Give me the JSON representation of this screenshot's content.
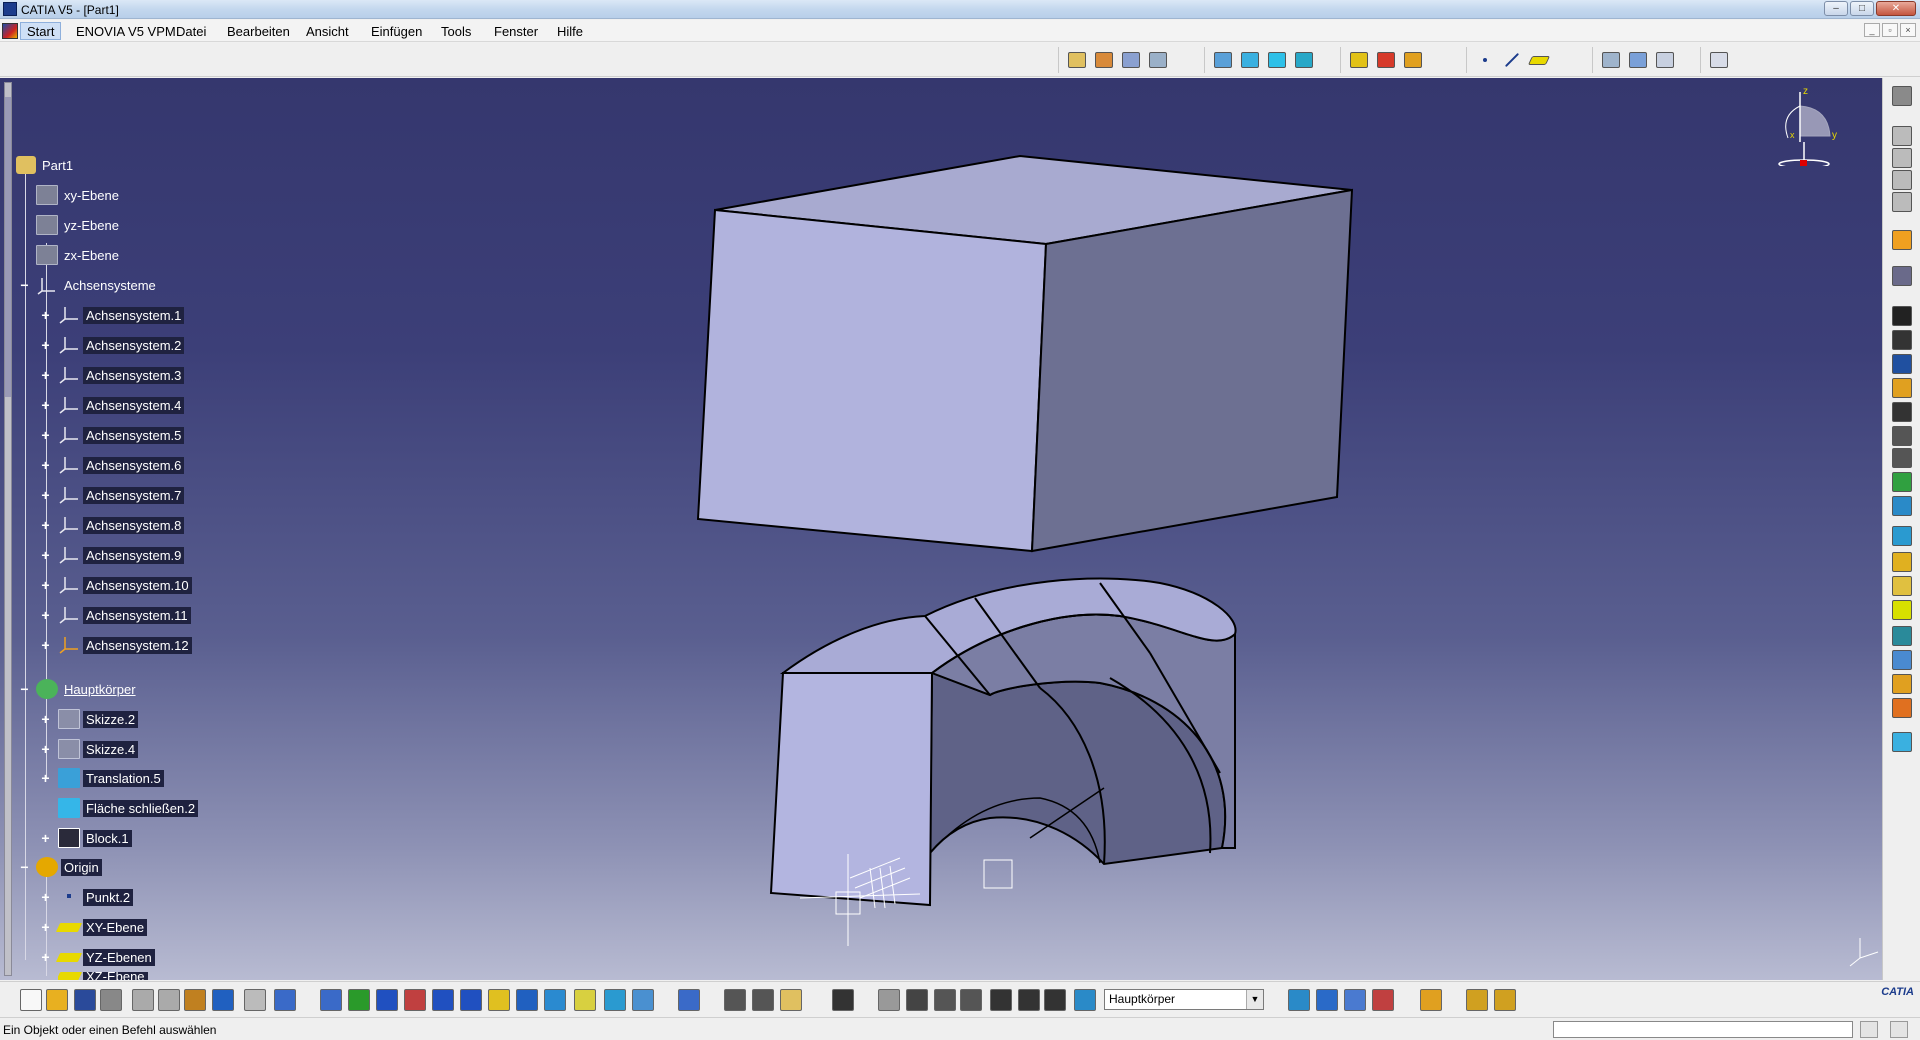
{
  "window": {
    "title": "CATIA V5 - [Part1]",
    "minimize": "–",
    "maximize": "□",
    "close": "✕"
  },
  "menu": {
    "start": "Start",
    "items": [
      "ENOVIA V5 VPM",
      "Datei",
      "Bearbeiten",
      "Ansicht",
      "Einfügen",
      "Tools",
      "Fenster",
      "Hilfe"
    ]
  },
  "tree": {
    "root": "Part1",
    "planes": [
      "xy-Ebene",
      "yz-Ebene",
      "zx-Ebene"
    ],
    "axis_group": "Achsensysteme",
    "axis_systems": [
      "Achsensystem.1",
      "Achsensystem.2",
      "Achsensystem.3",
      "Achsensystem.4",
      "Achsensystem.5",
      "Achsensystem.6",
      "Achsensystem.7",
      "Achsensystem.8",
      "Achsensystem.9",
      "Achsensystem.10",
      "Achsensystem.11",
      "Achsensystem.12"
    ],
    "body": "Hauptkörper",
    "body_children": [
      "Skizze.2",
      "Skizze.4",
      "Translation.5",
      "Fläche schließen.2",
      "Block.1"
    ],
    "origin": "Origin",
    "origin_children": [
      "Punkt.2",
      "XY-Ebene",
      "YZ-Ebenen",
      "XZ-Ebene"
    ]
  },
  "compass": {
    "z": "z",
    "y": "y",
    "x": "x"
  },
  "bottom_toolbar": {
    "body_select": "Hauptkörper"
  },
  "status": {
    "message": "Ein Objekt oder einen Befehl auswählen"
  },
  "colors": {
    "viewport_top": "#35376e",
    "viewport_bottom": "#b8bbd2",
    "solid_face_light": "#b3b5e0",
    "solid_face_dark": "#6e7193"
  }
}
